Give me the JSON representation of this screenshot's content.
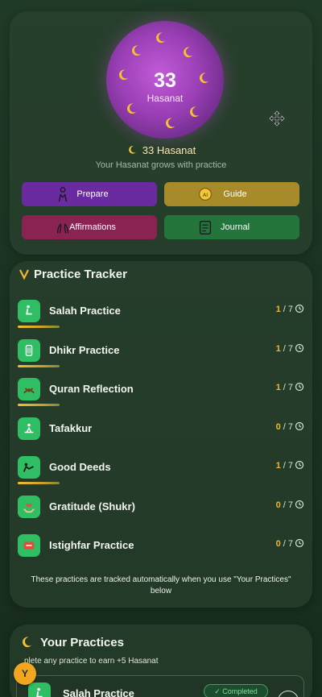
{
  "hero": {
    "orb_value": "33",
    "orb_label": "Hasanat",
    "hasanat_line": "33 Hasanat",
    "subtitle": "Your Hasanat grows with practice",
    "buttons": {
      "prepare": "Prepare",
      "guide": "Guide",
      "affirmations": "Affirmations",
      "journal": "Journal"
    }
  },
  "tracker": {
    "title": "Practice Tracker",
    "items": [
      {
        "label": "Salah Practice",
        "current": "1",
        "total": "/ 7"
      },
      {
        "label": "Dhikr Practice",
        "current": "1",
        "total": "/ 7"
      },
      {
        "label": "Quran Reflection",
        "current": "1",
        "total": "/ 7"
      },
      {
        "label": "Tafakkur",
        "current": "0",
        "total": "/ 7"
      },
      {
        "label": "Good Deeds",
        "current": "1",
        "total": "/ 7"
      },
      {
        "label": "Gratitude (Shukr)",
        "current": "0",
        "total": "/ 7"
      },
      {
        "label": "Istighfar Practice",
        "current": "0",
        "total": "/ 7"
      }
    ],
    "note": "These practices are tracked automatically when you use \"Your Practices\" below"
  },
  "your_practices": {
    "title": "Your Practices",
    "subtitle": "plete any practice to earn +5 Hasanat",
    "avatar_letter": "Y",
    "first_item": {
      "label": "Salah Practice",
      "status": "✓ Completed"
    }
  },
  "colors": {
    "accent_gold": "#f2b532",
    "prepare": "#6a2aa0",
    "guide": "#a78b2a",
    "affirmations": "#8a2352",
    "journal": "#23753c"
  }
}
